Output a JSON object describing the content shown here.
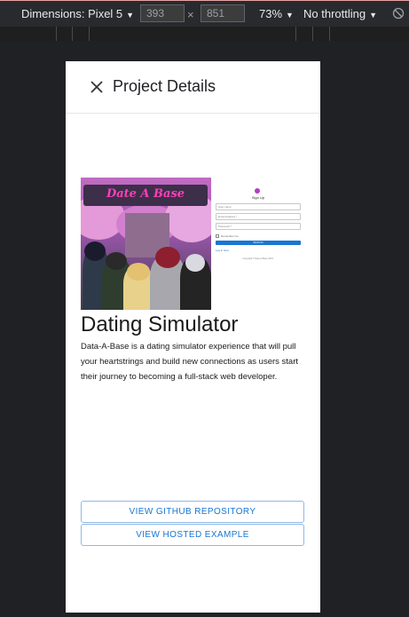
{
  "devtools": {
    "dimensions_label": "Dimensions: Pixel 5",
    "width_value": "393",
    "times": "×",
    "height_value": "851",
    "zoom": "73%",
    "throttling": "No throttling",
    "caret": "▼",
    "rotate_icon": "rotate-icon"
  },
  "dialog": {
    "title": "Project Details",
    "close_icon": "close-icon"
  },
  "project": {
    "logo_text": "Date A Base",
    "signup_preview": {
      "title": "Sign Up",
      "fields": [
        "User name",
        "Email Address *",
        "Password *"
      ],
      "checkbox_label": "Remember me",
      "button_label": "SIGN IN",
      "link_left": "Log in here",
      "footer": "Copyright © Date-A-Base 2021."
    },
    "title": "Dating Simulator",
    "description": "Data-A-Base is a dating simulator experience that will pull your heartstrings and build new connections as users start their journey to becoming a full-stack web developer.",
    "buttons": {
      "github": "VIEW GITHUB REPOSITORY",
      "hosted": "VIEW HOSTED EXAMPLE"
    }
  },
  "colors": {
    "accent": "#1976d2",
    "devtools_bg": "#292a2d",
    "page_bg": "#202124"
  }
}
